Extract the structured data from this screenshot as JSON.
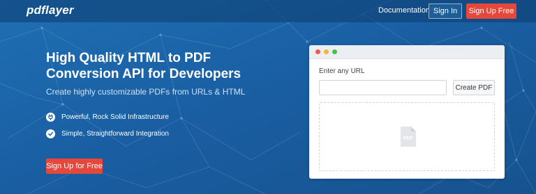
{
  "header": {
    "logo": "pdflayer",
    "nav_documentation": "Documentation",
    "sign_in": "Sign In",
    "sign_up": "Sign Up Free"
  },
  "hero": {
    "title": "High Quality HTML to PDF Conversion API for Developers",
    "subtitle": "Create highly customizable PDFs from URLs & HTML",
    "features": [
      {
        "icon": "power-plug-icon",
        "label": "Powerful, Rock Solid Infrastructure"
      },
      {
        "icon": "check-circle-icon",
        "label": "Simple, Straightforward Integration"
      }
    ],
    "cta": "Sign Up for Free"
  },
  "demo": {
    "url_label": "Enter any URL",
    "url_value": "",
    "url_placeholder": "",
    "create_button": "Create PDF",
    "preview_icon": "pdf-file-icon",
    "preview_icon_text": "PDF"
  },
  "colors": {
    "background": "#1a5fa3",
    "accent_red": "#e5473a",
    "window_dot_red": "#ee5b4f",
    "window_dot_yellow": "#f2b637",
    "window_dot_green": "#46c056"
  }
}
